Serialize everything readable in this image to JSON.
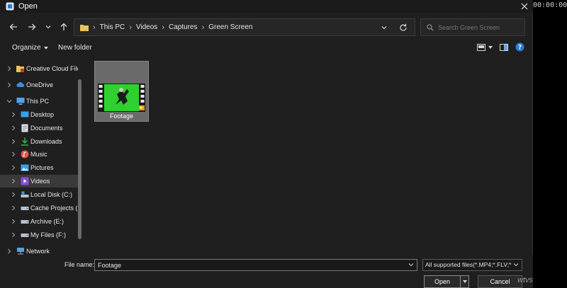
{
  "window": {
    "title": "Open",
    "timecode": "00:00:00:00"
  },
  "address": {
    "crumbs": [
      "This PC",
      "Videos",
      "Captures",
      "Green Screen"
    ],
    "search_placeholder": "Search Green Screen"
  },
  "toolbar": {
    "organize": "Organize",
    "new_folder": "New folder"
  },
  "sidebar": {
    "items": [
      {
        "label": "Creative Cloud Files",
        "icon": "creative-cloud-folder-icon"
      },
      {
        "label": "OneDrive",
        "icon": "cloud-icon"
      },
      {
        "label": "This PC",
        "icon": "computer-icon"
      },
      {
        "label": "Desktop",
        "icon": "desktop-icon"
      },
      {
        "label": "Documents",
        "icon": "documents-icon"
      },
      {
        "label": "Downloads",
        "icon": "download-icon"
      },
      {
        "label": "Music",
        "icon": "music-icon"
      },
      {
        "label": "Pictures",
        "icon": "pictures-icon"
      },
      {
        "label": "Videos",
        "icon": "videos-icon",
        "selected": true
      },
      {
        "label": "Local Disk (C:)",
        "icon": "drive-icon"
      },
      {
        "label": "Cache Projects (I",
        "icon": "drive-icon"
      },
      {
        "label": "Archive (E:)",
        "icon": "drive-icon"
      },
      {
        "label": "My Files (F:)",
        "icon": "drive-icon"
      },
      {
        "label": "Network",
        "icon": "network-icon"
      }
    ]
  },
  "files": [
    {
      "name": "Footage",
      "type": "video",
      "selected": true
    }
  ],
  "footer": {
    "file_name_label": "File name:",
    "file_name_value": "Footage",
    "filter": "All supported files(*.MP4;*.FLV;*",
    "open": "Open",
    "cancel": "Cancel",
    "watermark": "wtvs"
  },
  "colors": {
    "dialog_bg": "#1f1f1f",
    "selected_tile": "#6a6a6a",
    "green_screen": "#2fd12f",
    "accent_blue": "#2b7bd6"
  }
}
